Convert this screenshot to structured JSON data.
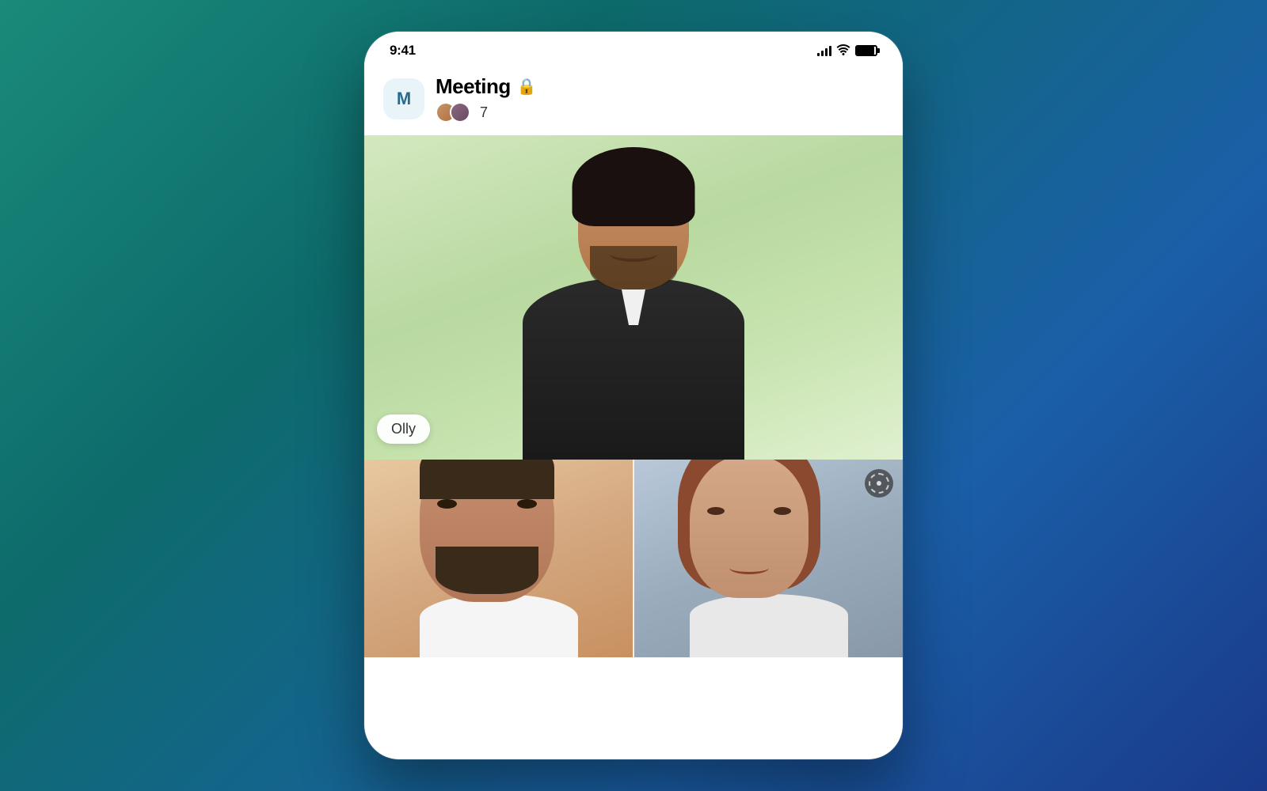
{
  "background": {
    "gradient_start": "#1a8a7a",
    "gradient_end": "#1a3a8a"
  },
  "status_bar": {
    "time": "9:41",
    "signal_label": "signal bars",
    "wifi_label": "wifi",
    "battery_label": "battery"
  },
  "header": {
    "avatar_letter": "M",
    "meeting_title": "Meeting",
    "lock_icon": "🔒",
    "participant_count": "7"
  },
  "main_video": {
    "speaker_name": "Olly",
    "background_color_start": "#d4e8c0",
    "background_color_end": "#e0f0d0"
  },
  "bottom_tiles": [
    {
      "id": "tile-1",
      "person": "person-2",
      "background": "warm"
    },
    {
      "id": "tile-2",
      "person": "person-3",
      "background": "cool",
      "has_options": true
    }
  ],
  "participants": [
    {
      "id": "p1",
      "color": "#c8956a"
    },
    {
      "id": "p2",
      "color": "#8a6a5a"
    }
  ]
}
